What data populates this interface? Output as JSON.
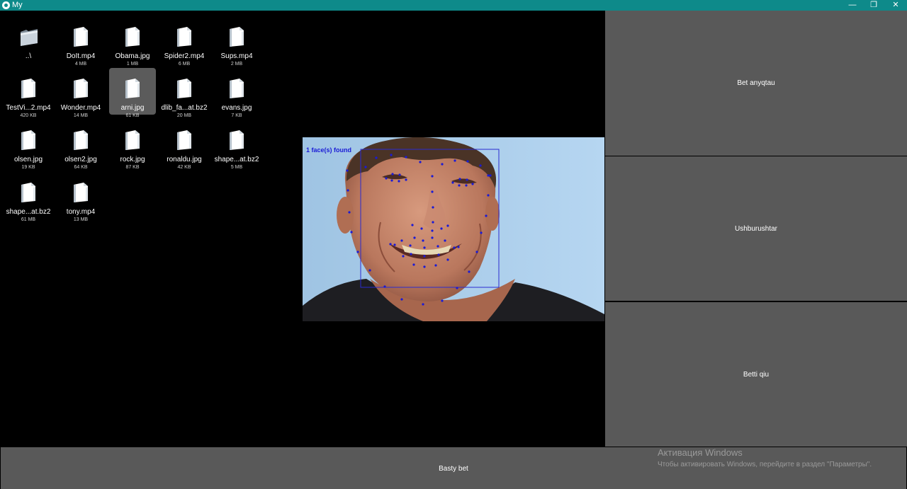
{
  "window": {
    "title": "My",
    "controls": {
      "minimize": "—",
      "maximize": "❐",
      "close": "✕"
    }
  },
  "files": [
    {
      "name": "..\\",
      "size": "",
      "type": "folder"
    },
    {
      "name": "DoIt.mp4",
      "size": "4 MB",
      "type": "file"
    },
    {
      "name": "Obama.jpg",
      "size": "1 MB",
      "type": "file"
    },
    {
      "name": "Spider2.mp4",
      "size": "6 MB",
      "type": "file"
    },
    {
      "name": "Sups.mp4",
      "size": "2 MB",
      "type": "file"
    },
    {
      "name": "TestVi...2.mp4",
      "size": "420 KB",
      "type": "file"
    },
    {
      "name": "Wonder.mp4",
      "size": "14 MB",
      "type": "file"
    },
    {
      "name": "arni.jpg",
      "size": "61 KB",
      "type": "file",
      "selected": true
    },
    {
      "name": "dlib_fa...at.bz2",
      "size": "20 MB",
      "type": "file"
    },
    {
      "name": "evans.jpg",
      "size": "7 KB",
      "type": "file"
    },
    {
      "name": "olsen.jpg",
      "size": "19 KB",
      "type": "file"
    },
    {
      "name": "olsen2.jpg",
      "size": "64 KB",
      "type": "file"
    },
    {
      "name": "rock.jpg",
      "size": "87 KB",
      "type": "file"
    },
    {
      "name": "ronaldu.jpg",
      "size": "42 KB",
      "type": "file"
    },
    {
      "name": "shape...at.bz2",
      "size": "5 MB",
      "type": "file"
    },
    {
      "name": "shape...at.bz2",
      "size": "61 MB",
      "type": "file"
    },
    {
      "name": "tony.mp4",
      "size": "13 MB",
      "type": "file"
    }
  ],
  "preview": {
    "overlay_text": "1 face(s) found",
    "overlay_color": "#1a1ad6"
  },
  "buttons": {
    "detect": "Bet anyqtau",
    "triangles": "Ushburushtar",
    "face": "Betti qiu",
    "main": "Basty bet"
  },
  "watermark": {
    "title": "Активация Windows",
    "subtitle": "Чтобы активировать Windows, перейдите в раздел \"Параметры\"."
  },
  "colors": {
    "titlebar": "#0e8a8a",
    "button_bg": "#595959",
    "selected_bg": "#5b5b5b",
    "sky": "#a9cbe8"
  }
}
